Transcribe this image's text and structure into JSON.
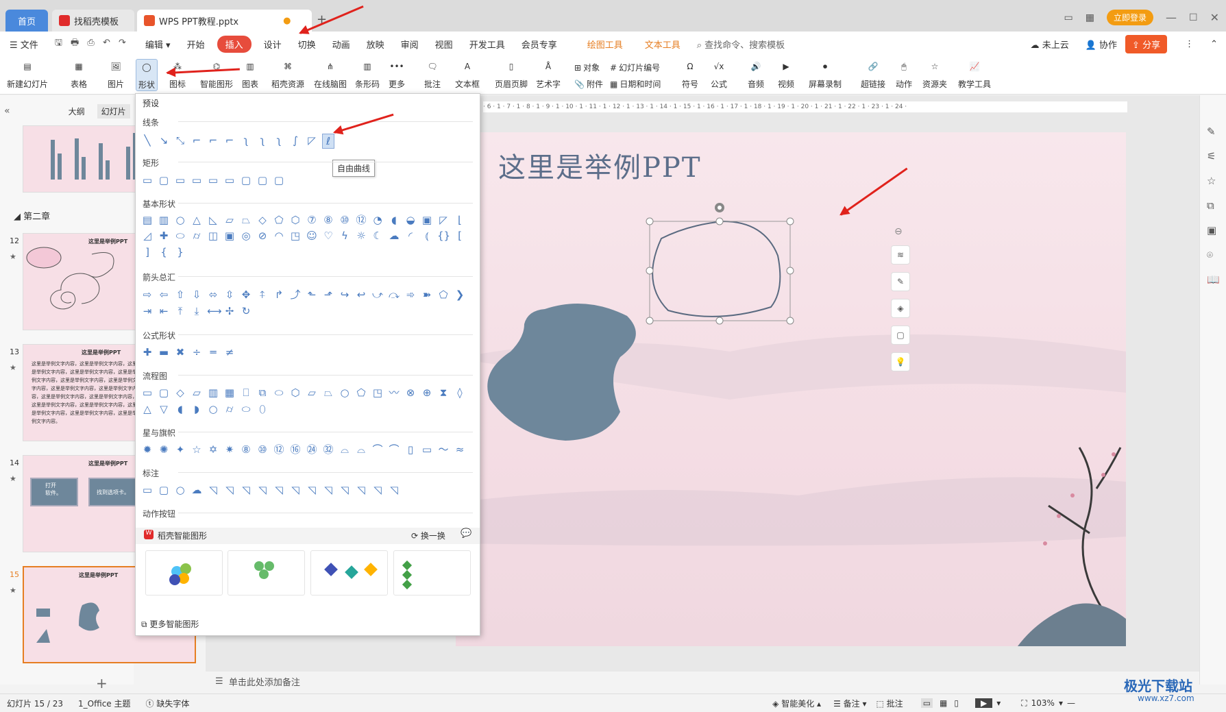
{
  "titlebar": {
    "tab_home": "首页",
    "tab_template": "找稻壳模板",
    "tab_doc": "WPS PPT教程.pptx",
    "login": "立即登录"
  },
  "menubar": {
    "file": "文件",
    "edit": "编辑",
    "items": [
      "开始",
      "插入",
      "设计",
      "切换",
      "动画",
      "放映",
      "审阅",
      "视图",
      "开发工具",
      "会员专享"
    ],
    "draw_tool": "绘图工具",
    "text_tool": "文本工具",
    "search_placeholder": "查找命令、搜索模板",
    "cloud": "未上云",
    "collab": "协作",
    "share": "分享"
  },
  "ribbon": {
    "new_slide": "新建幻灯片",
    "table": "表格",
    "picture": "图片",
    "shape": "形状",
    "icon": "图标",
    "smart_shape": "智能图形",
    "chart": "图表",
    "docer": "稻壳资源",
    "mindmap": "在线脑图",
    "barcode": "条形码",
    "more": "更多",
    "comment": "批注",
    "textbox": "文本框",
    "header_footer": "页眉页脚",
    "wordart": "艺术字",
    "object": "对象",
    "attachment": "附件",
    "slide_number": "幻灯片编号",
    "datetime": "日期和时间",
    "symbol": "符号",
    "formula": "公式",
    "audio": "音频",
    "video": "视频",
    "screen_record": "屏幕录制",
    "hyperlink": "超链接",
    "action": "动作",
    "resource": "资源夹",
    "teach_tool": "教学工具"
  },
  "leftpane": {
    "tab_outline": "大纲",
    "tab_slides": "幻灯片",
    "chapter": "第二章",
    "slides": [
      {
        "num": "12",
        "title": "这里是举例PPT"
      },
      {
        "num": "13",
        "title": "这里是举例PPT",
        "body": "这里是举例文字内容，这里是举例文字内容，这里是举例文字内容，这里是举例文字内容，这里是举例文字内容，这里是举例文字内容，这里是举例文字内容，这里是举例文字内容，这里是举例文字内容，这里是举例文字内容，这里是举例文字内容，这里是举例文字内容，这里是举例文字内容，这里是举例文字内容，这里是举例文字内容，这里是举例文字内容。"
      },
      {
        "num": "14",
        "title": "这里是举例PPT",
        "box1": "打开\n软件。",
        "box2": "找到选项卡。"
      },
      {
        "num": "15",
        "title": "这里是举例PPT"
      }
    ]
  },
  "shape_panel": {
    "preset": "预设",
    "sections": [
      "线条",
      "矩形",
      "基本形状",
      "箭头总汇",
      "公式形状",
      "流程图",
      "星与旗帜",
      "标注",
      "动作按钮"
    ],
    "tooltip": "自由曲线",
    "smart_title": "稻壳智能图形",
    "swap": "换一换",
    "more_smart": "更多智能图形"
  },
  "slide": {
    "title": "这里是举例PPT"
  },
  "notes": "单击此处添加备注",
  "status": {
    "slide_count": "幻灯片 15 / 23",
    "theme": "1_Office 主题",
    "missing_font": "缺失字体",
    "beautify": "智能美化",
    "notes": "备注",
    "comment": "批注",
    "zoom": "103%"
  },
  "watermark": {
    "name": "极光下载站",
    "url": "www.xz7.com"
  },
  "colors": {
    "accent": "#e74c3c",
    "shape_fill": "#6e879b",
    "slide_bg": "#f5e1e7",
    "tab_blue": "#4a89dc"
  }
}
